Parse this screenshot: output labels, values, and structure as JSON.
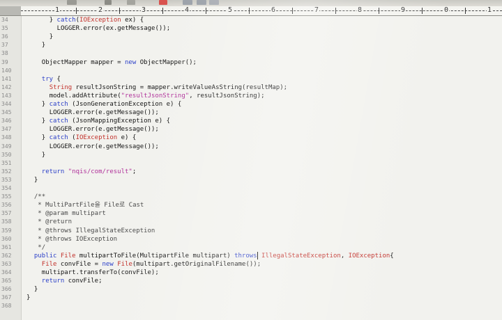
{
  "ruler": {
    "marks": [
      "1",
      "2",
      "3",
      "4",
      "5",
      "6",
      "7",
      "8",
      "9",
      "0",
      "1"
    ]
  },
  "lines": [
    {
      "ln": "34",
      "indent": 6,
      "segs": [
        {
          "t": "} ",
          "c": ""
        },
        {
          "t": "catch",
          "c": "kw"
        },
        {
          "t": "(",
          "c": ""
        },
        {
          "t": "IOException",
          "c": "ty"
        },
        {
          "t": " ex) {",
          "c": ""
        }
      ]
    },
    {
      "ln": "35",
      "indent": 8,
      "segs": [
        {
          "t": "LOGGER.error(ex.getMessage());",
          "c": ""
        }
      ]
    },
    {
      "ln": "36",
      "indent": 6,
      "segs": [
        {
          "t": "}",
          "c": ""
        }
      ]
    },
    {
      "ln": "37",
      "indent": 4,
      "segs": [
        {
          "t": "}",
          "c": ""
        }
      ]
    },
    {
      "ln": "38",
      "indent": 0,
      "segs": []
    },
    {
      "ln": "39",
      "indent": 4,
      "segs": [
        {
          "t": "ObjectMapper mapper = ",
          "c": ""
        },
        {
          "t": "new",
          "c": "kw"
        },
        {
          "t": " ObjectMapper();",
          "c": ""
        }
      ]
    },
    {
      "ln": "140",
      "indent": 0,
      "segs": []
    },
    {
      "ln": "141",
      "indent": 4,
      "segs": [
        {
          "t": "try",
          "c": "kw"
        },
        {
          "t": " {",
          "c": ""
        }
      ]
    },
    {
      "ln": "142",
      "indent": 6,
      "segs": [
        {
          "t": "String",
          "c": "ty"
        },
        {
          "t": " resultJsonString = mapper.writeValueAsString(resultMap);",
          "c": ""
        }
      ]
    },
    {
      "ln": "143",
      "indent": 6,
      "segs": [
        {
          "t": "model.addAttribute(",
          "c": ""
        },
        {
          "t": "\"resultJsonString\"",
          "c": "str"
        },
        {
          "t": ", resultJsonString);",
          "c": ""
        }
      ]
    },
    {
      "ln": "344",
      "indent": 4,
      "segs": [
        {
          "t": "} ",
          "c": ""
        },
        {
          "t": "catch",
          "c": "kw"
        },
        {
          "t": " (JsonGenerationException e) {",
          "c": ""
        }
      ]
    },
    {
      "ln": "345",
      "indent": 6,
      "segs": [
        {
          "t": "LOGGER.error(e.getMessage());",
          "c": ""
        }
      ]
    },
    {
      "ln": "346",
      "indent": 4,
      "segs": [
        {
          "t": "} ",
          "c": ""
        },
        {
          "t": "catch",
          "c": "kw"
        },
        {
          "t": " (JsonMappingException e) {",
          "c": ""
        }
      ]
    },
    {
      "ln": "347",
      "indent": 6,
      "segs": [
        {
          "t": "LOGGER.error(e.getMessage());",
          "c": ""
        }
      ]
    },
    {
      "ln": "348",
      "indent": 4,
      "segs": [
        {
          "t": "} ",
          "c": ""
        },
        {
          "t": "catch",
          "c": "kw"
        },
        {
          "t": " (",
          "c": ""
        },
        {
          "t": "IOException",
          "c": "ty"
        },
        {
          "t": " e) {",
          "c": ""
        }
      ]
    },
    {
      "ln": "349",
      "indent": 6,
      "segs": [
        {
          "t": "LOGGER.error(e.getMessage());",
          "c": ""
        }
      ]
    },
    {
      "ln": "350",
      "indent": 4,
      "segs": [
        {
          "t": "}",
          "c": ""
        }
      ]
    },
    {
      "ln": "351",
      "indent": 0,
      "segs": []
    },
    {
      "ln": "352",
      "indent": 4,
      "segs": [
        {
          "t": "return",
          "c": "kw"
        },
        {
          "t": " ",
          "c": ""
        },
        {
          "t": "\"nqis/com/result\"",
          "c": "str"
        },
        {
          "t": ";",
          "c": ""
        }
      ]
    },
    {
      "ln": "353",
      "indent": 2,
      "segs": [
        {
          "t": "}",
          "c": ""
        }
      ]
    },
    {
      "ln": "354",
      "indent": 0,
      "segs": []
    },
    {
      "ln": "355",
      "indent": 2,
      "segs": [
        {
          "t": "/**",
          "c": "cm"
        }
      ]
    },
    {
      "ln": "356",
      "indent": 2,
      "segs": [
        {
          "t": " * MultiPartFile을 File로 Cast",
          "c": "cm"
        }
      ]
    },
    {
      "ln": "357",
      "indent": 2,
      "segs": [
        {
          "t": " * @param multipart",
          "c": "cm"
        }
      ]
    },
    {
      "ln": "358",
      "indent": 2,
      "segs": [
        {
          "t": " * @return",
          "c": "cm"
        }
      ]
    },
    {
      "ln": "359",
      "indent": 2,
      "segs": [
        {
          "t": " * @throws IllegalStateException",
          "c": "cm"
        }
      ]
    },
    {
      "ln": "360",
      "indent": 2,
      "segs": [
        {
          "t": " * @throws IOException",
          "c": "cm"
        }
      ]
    },
    {
      "ln": "361",
      "indent": 2,
      "segs": [
        {
          "t": " */",
          "c": "cm"
        }
      ]
    },
    {
      "ln": "362",
      "indent": 2,
      "segs": [
        {
          "t": "public",
          "c": "kw"
        },
        {
          "t": " ",
          "c": ""
        },
        {
          "t": "File",
          "c": "ty"
        },
        {
          "t": " multipartToFile(MultipartFile multipart) ",
          "c": ""
        },
        {
          "t": "throws",
          "c": "kw"
        },
        {
          "t": "|",
          "c": "caret"
        },
        {
          "t": " IllegalStateException",
          "c": "ty"
        },
        {
          "t": ", ",
          "c": ""
        },
        {
          "t": "IOException",
          "c": "ty"
        },
        {
          "t": "{",
          "c": ""
        }
      ]
    },
    {
      "ln": "363",
      "indent": 4,
      "segs": [
        {
          "t": "File",
          "c": "ty"
        },
        {
          "t": " convFile = ",
          "c": ""
        },
        {
          "t": "new",
          "c": "kw"
        },
        {
          "t": " ",
          "c": ""
        },
        {
          "t": "File",
          "c": "ty"
        },
        {
          "t": "(multipart.getOriginalFilename());",
          "c": ""
        }
      ]
    },
    {
      "ln": "364",
      "indent": 4,
      "segs": [
        {
          "t": "multipart.transferTo(convFile);",
          "c": ""
        }
      ]
    },
    {
      "ln": "365",
      "indent": 4,
      "segs": [
        {
          "t": "return",
          "c": "kw"
        },
        {
          "t": " convFile;",
          "c": ""
        }
      ]
    },
    {
      "ln": "366",
      "indent": 2,
      "segs": [
        {
          "t": "}",
          "c": ""
        }
      ]
    },
    {
      "ln": "367",
      "indent": 0,
      "segs": [
        {
          "t": "}",
          "c": ""
        }
      ]
    },
    {
      "ln": "368",
      "indent": 0,
      "segs": []
    }
  ]
}
